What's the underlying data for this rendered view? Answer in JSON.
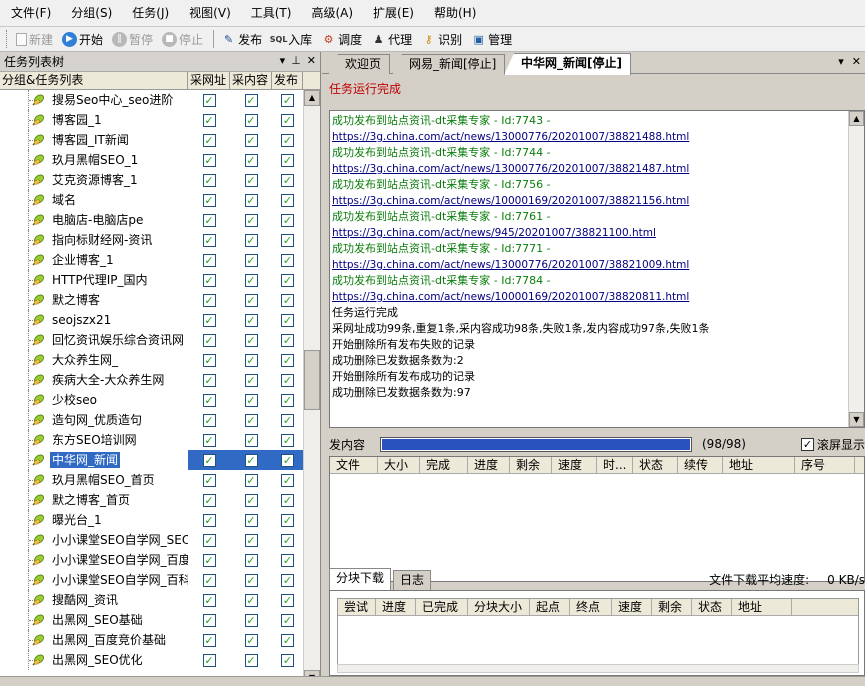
{
  "menu": [
    "文件(F)",
    "分组(S)",
    "任务(J)",
    "视图(V)",
    "工具(T)",
    "高级(A)",
    "扩展(E)",
    "帮助(H)"
  ],
  "toolbar": {
    "new_label": "新建",
    "start_label": "开始",
    "pause_label": "暂停",
    "stop_label": "停止",
    "publish_label": "发布",
    "import_label": "入库",
    "dispatch_label": "调度",
    "proxy_label": "代理",
    "recognize_label": "识别",
    "manage_label": "管理"
  },
  "left_panel": {
    "title": "任务列表树",
    "columns": [
      "分组&任务列表",
      "采网址",
      "采内容",
      "发布"
    ],
    "items": [
      "搜易Seo中心_seo进阶",
      "博客园_1",
      "博客园_IT新闻",
      "玖月黑帽SEO_1",
      "艾克资源博客_1",
      "域名",
      "电脑店-电脑店pe",
      "指向标财经网-资讯",
      "企业博客_1",
      "HTTP代理IP_国内",
      "默之博客",
      "seojszx21",
      "回忆资讯娱乐综合资讯网",
      "大众养生网_",
      "疾病大全-大众养生网",
      "少校seo",
      "造句网_优质造句",
      "东方SEO培训网",
      "中华网_新闻",
      "玖月黑帽SEO_首页",
      "默之博客_首页",
      "曝光台_1",
      "小小课堂SEO自学网_SEO",
      "小小课堂SEO自学网_百度",
      "小小课堂SEO自学网_百科",
      "搜酷网_资讯",
      "出黑网_SEO基础",
      "出黑网_百度竞价基础",
      "出黑网_SEO优化"
    ],
    "selected_index": 18
  },
  "tabs": [
    "欢迎页",
    "网易_新闻[停止]",
    "中华网_新闻[停止]"
  ],
  "active_tab": 2,
  "task_status": "任务运行完成",
  "log": [
    {
      "type": "green",
      "text": "成功发布到站点资讯-dt采集专家 - Id:7743 -"
    },
    {
      "type": "link",
      "text": "https://3g.china.com/act/news/13000776/20201007/38821488.html"
    },
    {
      "type": "green",
      "text": "成功发布到站点资讯-dt采集专家 - Id:7744 -"
    },
    {
      "type": "link",
      "text": "https://3g.china.com/act/news/13000776/20201007/38821487.html"
    },
    {
      "type": "green",
      "text": "成功发布到站点资讯-dt采集专家 - Id:7756 -"
    },
    {
      "type": "link",
      "text": "https://3g.china.com/act/news/10000169/20201007/38821156.html"
    },
    {
      "type": "green",
      "text": "成功发布到站点资讯-dt采集专家 - Id:7761 -"
    },
    {
      "type": "link",
      "text": "https://3g.china.com/act/news/945/20201007/38821100.html"
    },
    {
      "type": "green",
      "text": "成功发布到站点资讯-dt采集专家 - Id:7771 -"
    },
    {
      "type": "link",
      "text": "https://3g.china.com/act/news/13000776/20201007/38821009.html"
    },
    {
      "type": "green",
      "text": "成功发布到站点资讯-dt采集专家 - Id:7784 -"
    },
    {
      "type": "link",
      "text": "https://3g.china.com/act/news/10000169/20201007/38820811.html"
    },
    {
      "type": "black",
      "text": "任务运行完成"
    },
    {
      "type": "black",
      "text": "采网址成功99条,重复1条,采内容成功98条,失败1条,发内容成功97条,失败1条"
    },
    {
      "type": "black",
      "text": "开始删除所有发布失败的记录"
    },
    {
      "type": "black",
      "text": "成功删除已发数据条数为:2"
    },
    {
      "type": "black",
      "text": "开始删除所有发布成功的记录"
    },
    {
      "type": "black",
      "text": "成功删除已发数据条数为:97"
    }
  ],
  "progress": {
    "label": "发内容",
    "count_text": "(98/98)",
    "fraction": 1.0,
    "autoscroll_label": "滚屏显示",
    "autoscroll_checked": true
  },
  "file_table": {
    "columns": [
      "文件",
      "大小",
      "完成",
      "进度",
      "剩余",
      "速度",
      "时...",
      "状态",
      "续传",
      "地址",
      "序号"
    ]
  },
  "bottom_tabs": [
    "分块下载",
    "日志"
  ],
  "speed": {
    "label": "文件下载平均速度:",
    "value": "0 KB/s"
  },
  "chunk_table": {
    "columns": [
      "尝试",
      "进度",
      "已完成",
      "分块大小",
      "起点",
      "终点",
      "速度",
      "剩余",
      "状态",
      "地址"
    ]
  },
  "colors": {
    "selection": "#316ac5",
    "progress": "#2a52be",
    "log_green": "#0a7d0a",
    "status_red": "#c00000"
  }
}
